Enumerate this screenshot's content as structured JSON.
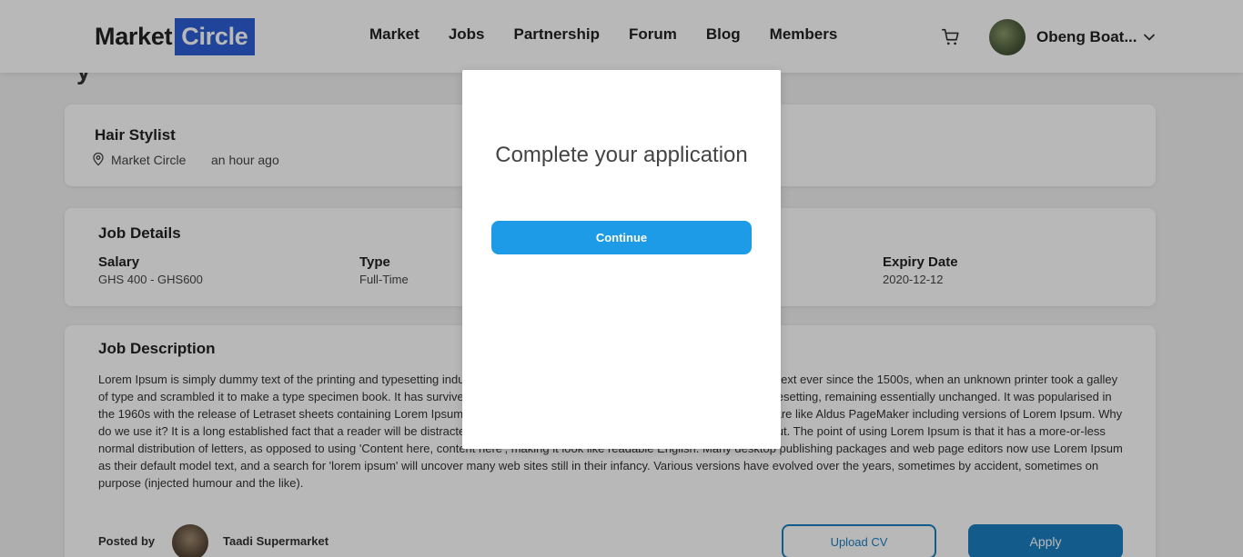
{
  "header": {
    "logo_part1": "Market",
    "logo_part2": "Circle",
    "nav": [
      "Market",
      "Jobs",
      "Partnership",
      "Forum",
      "Blog",
      "Members"
    ],
    "user_name": "Obeng Boat...",
    "icons": [
      "cart-icon",
      "chevron-down-icon"
    ]
  },
  "job": {
    "title": "Hair Stylist",
    "location": "Market Circle",
    "posted_time": "an hour ago"
  },
  "details": {
    "section_title": "Job Details",
    "salary_label": "Salary",
    "salary_value": "GHS 400 - GHS600",
    "type_label": "Type",
    "type_value": "Full-Time",
    "expiry_label": "Expiry Date",
    "expiry_value": "2020-12-12"
  },
  "description": {
    "section_title": "Job Description",
    "text": "Lorem Ipsum is simply dummy text of the printing and typesetting industry. Lorem Ipsum has been the industry's standard dummy text ever since the 1500s, when an unknown printer took a galley of type and scrambled it to make a type specimen book. It has survived not only five centuries, but also the leap into electronic typesetting, remaining essentially unchanged. It was popularised in the 1960s with the release of Letraset sheets containing Lorem Ipsum passages, and more recently with desktop publishing software like Aldus PageMaker including versions of Lorem Ipsum. Why do we use it? It is a long established fact that a reader will be distracted by the readable content of a page when looking at its layout. The point of using Lorem Ipsum is that it has a more-or-less normal distribution of letters, as opposed to using 'Content here, content here', making it look like readable English. Many desktop publishing packages and web page editors now use Lorem Ipsum as their default model text, and a search for 'lorem ipsum' will uncover many web sites still in their infancy. Various versions have evolved over the years, sometimes by accident, sometimes on purpose (injected humour and the like)."
  },
  "posted": {
    "label": "Posted by",
    "name": "Taadi Supermarket",
    "upload_label": "Upload CV",
    "apply_label": "Apply"
  },
  "modal": {
    "title": "Complete your application",
    "continue_label": "Continue"
  },
  "colors": {
    "brand_blue": "#2c5fd6",
    "primary": "#1a7fc1",
    "continue": "#1d9be6"
  }
}
